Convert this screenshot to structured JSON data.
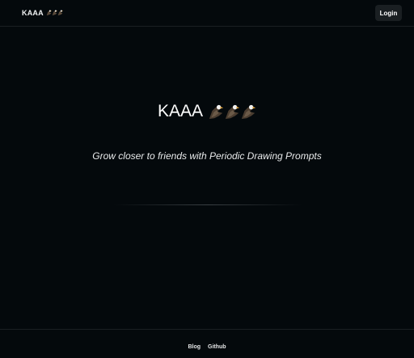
{
  "header": {
    "brand_text": "KAAA",
    "brand_icons": [
      "eagle-icon",
      "eagle-icon",
      "eagle-icon"
    ],
    "login_label": "Login"
  },
  "hero": {
    "title_text": "KAAA",
    "title_icons": [
      "eagle-icon",
      "eagle-icon",
      "eagle-icon"
    ],
    "tagline": "Grow closer to friends with Periodic Drawing Prompts"
  },
  "footer": {
    "links": [
      {
        "label": "Blog"
      },
      {
        "label": "Github"
      }
    ]
  },
  "colors": {
    "background": "#04090c",
    "border": "#1b2023",
    "button_bg": "#1a1f22",
    "text": "#ffffff",
    "eagle_body": "#5a4a3a",
    "eagle_head": "#f2f2f2",
    "eagle_beak": "#e0a23a"
  }
}
